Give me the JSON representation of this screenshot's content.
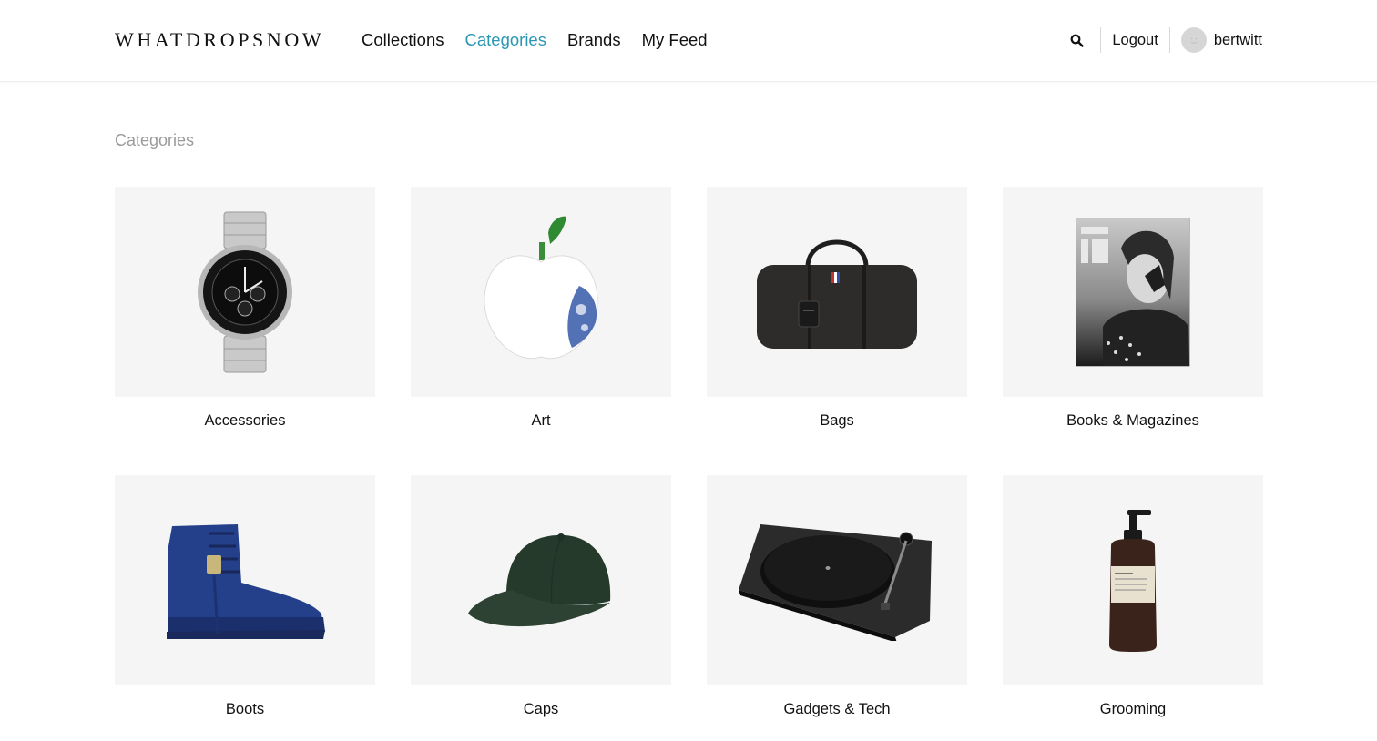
{
  "header": {
    "logo": "WHATDROPSNOW",
    "nav": [
      {
        "label": "Collections",
        "active": false
      },
      {
        "label": "Categories",
        "active": true
      },
      {
        "label": "Brands",
        "active": false
      },
      {
        "label": "My Feed",
        "active": false
      }
    ],
    "search_icon": "search-icon",
    "logout_label": "Logout",
    "username": "bertwitt"
  },
  "page": {
    "title": "Categories"
  },
  "categories": [
    {
      "label": "Accessories",
      "icon": "watch"
    },
    {
      "label": "Art",
      "icon": "apple-sculpture"
    },
    {
      "label": "Bags",
      "icon": "duffel-bag"
    },
    {
      "label": "Books & Magazines",
      "icon": "magazine"
    },
    {
      "label": "Boots",
      "icon": "boot"
    },
    {
      "label": "Caps",
      "icon": "cap"
    },
    {
      "label": "Gadgets & Tech",
      "icon": "turntable"
    },
    {
      "label": "Grooming",
      "icon": "soap-bottle"
    }
  ],
  "colors": {
    "accent": "#2b97b5",
    "card_bg": "#f5f5f5",
    "muted_text": "#9b9b9b"
  }
}
